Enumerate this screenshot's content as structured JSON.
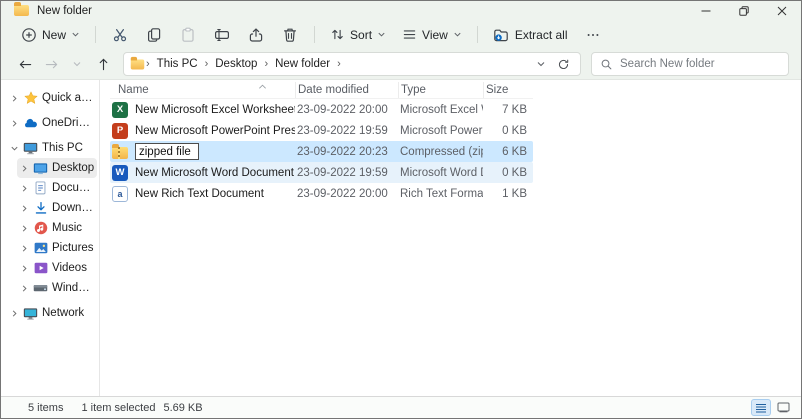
{
  "window": {
    "title": "New folder"
  },
  "toolbar": {
    "new_label": "New",
    "sort_label": "Sort",
    "view_label": "View",
    "extract_label": "Extract all"
  },
  "addressbar": {
    "crumbs": [
      "This PC",
      "Desktop",
      "New folder"
    ],
    "search_placeholder": "Search New folder"
  },
  "sidebar": {
    "quick_access": "Quick access",
    "onedrive": "OneDrive - Personal",
    "this_pc": "This PC",
    "desktop": "Desktop",
    "documents": "Documents",
    "downloads": "Downloads",
    "music": "Music",
    "pictures": "Pictures",
    "videos": "Videos",
    "windows_ssd": "Windows-SSD (C:)",
    "network": "Network"
  },
  "filelist": {
    "columns": {
      "name": "Name",
      "date": "Date modified",
      "type": "Type",
      "size": "Size"
    },
    "rows": [
      {
        "name": "New Microsoft Excel Worksheet",
        "date": "23-09-2022 20:00",
        "type": "Microsoft Excel Work...",
        "size": "7 KB",
        "icon": "excel-file-icon"
      },
      {
        "name": "New Microsoft PowerPoint Presentation",
        "date": "23-09-2022 19:59",
        "type": "Microsoft PowerPoint...",
        "size": "0 KB",
        "icon": "powerpoint-file-icon"
      },
      {
        "name": "zipped file",
        "date": "23-09-2022 20:23",
        "type": "Compressed (zipped)...",
        "size": "6 KB",
        "icon": "zip-file-icon"
      },
      {
        "name": "New Microsoft Word Document",
        "date": "23-09-2022 19:59",
        "type": "Microsoft Word Doc...",
        "size": "0 KB",
        "icon": "word-file-icon"
      },
      {
        "name": "New Rich Text Document",
        "date": "23-09-2022 20:00",
        "type": "Rich Text Format",
        "size": "1 KB",
        "icon": "rtf-file-icon"
      }
    ],
    "rename_value": "zipped file"
  },
  "statusbar": {
    "count": "5 items",
    "selected": "1 item selected",
    "selected_size": "5.69 KB"
  },
  "colors": {
    "selection": "#cce8ff",
    "hover": "#e7f2fb",
    "accent": "#0b6ac2",
    "chrome": "#eef3ee",
    "folder_yellow": "#f4b84e"
  }
}
